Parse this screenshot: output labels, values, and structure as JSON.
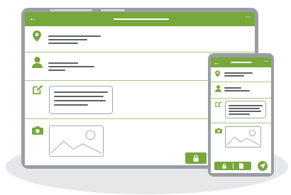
{
  "colors": {
    "accent": "#76a83a",
    "divider": "#a9c883",
    "device_frame": "#9a9ea3",
    "text_placeholder": "#5d6166",
    "floor_shadow": "#e6e7e9"
  },
  "tablet": {
    "appbar": {
      "back_icon": "←",
      "more_icon": "···"
    },
    "rows": [
      {
        "icon": "location-pin-icon"
      },
      {
        "icon": "user-icon"
      },
      {
        "icon": "edit-note-icon"
      },
      {
        "icon": "camera-icon"
      }
    ],
    "footer_buttons": [
      {
        "icon": "lock-icon"
      }
    ]
  },
  "phone": {
    "appbar": {
      "back_icon": "←",
      "more_icon": "···"
    },
    "rows": [
      {
        "icon": "location-pin-icon"
      },
      {
        "icon": "user-icon"
      },
      {
        "icon": "edit-note-icon"
      },
      {
        "icon": "camera-icon"
      }
    ],
    "nav_buttons": [
      {
        "icon": "lock-icon"
      },
      {
        "icon": "document-icon"
      }
    ],
    "send_button": {
      "icon": "send-icon"
    }
  }
}
